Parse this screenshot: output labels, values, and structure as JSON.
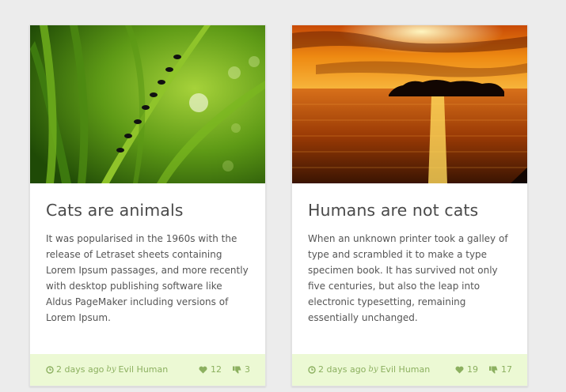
{
  "cards": [
    {
      "title": "Cats are animals",
      "text": "It was popularised in the 1960s with the release of Letraset sheets containing Lorem Ipsum passages, and more recently with desktop publishing software like Aldus PageMaker including versions of Lorem Ipsum.",
      "time": "2 days ago",
      "by": "by",
      "author": "Evil Human",
      "likes": "12",
      "dislikes": "3",
      "image": "grass-with-ants-photo"
    },
    {
      "title": "Humans are not cats",
      "text": "When an unknown printer took a galley of type and scrambled it to make a type specimen book. It has survived not only five centuries, but also the leap into electronic typesetting, remaining essentially unchanged.",
      "time": "2 days ago",
      "by": "by",
      "author": "Evil Human",
      "likes": "19",
      "dislikes": "17",
      "image": "sunset-lake-island-photo"
    }
  ],
  "colors": {
    "footer_bg": "#ecf9d4",
    "footer_text": "#8cb060",
    "title": "#4a4a4a",
    "background": "#ececec"
  },
  "icons": {
    "time": "clock-icon",
    "like": "heart-icon",
    "dislike": "thumbs-down-icon"
  }
}
